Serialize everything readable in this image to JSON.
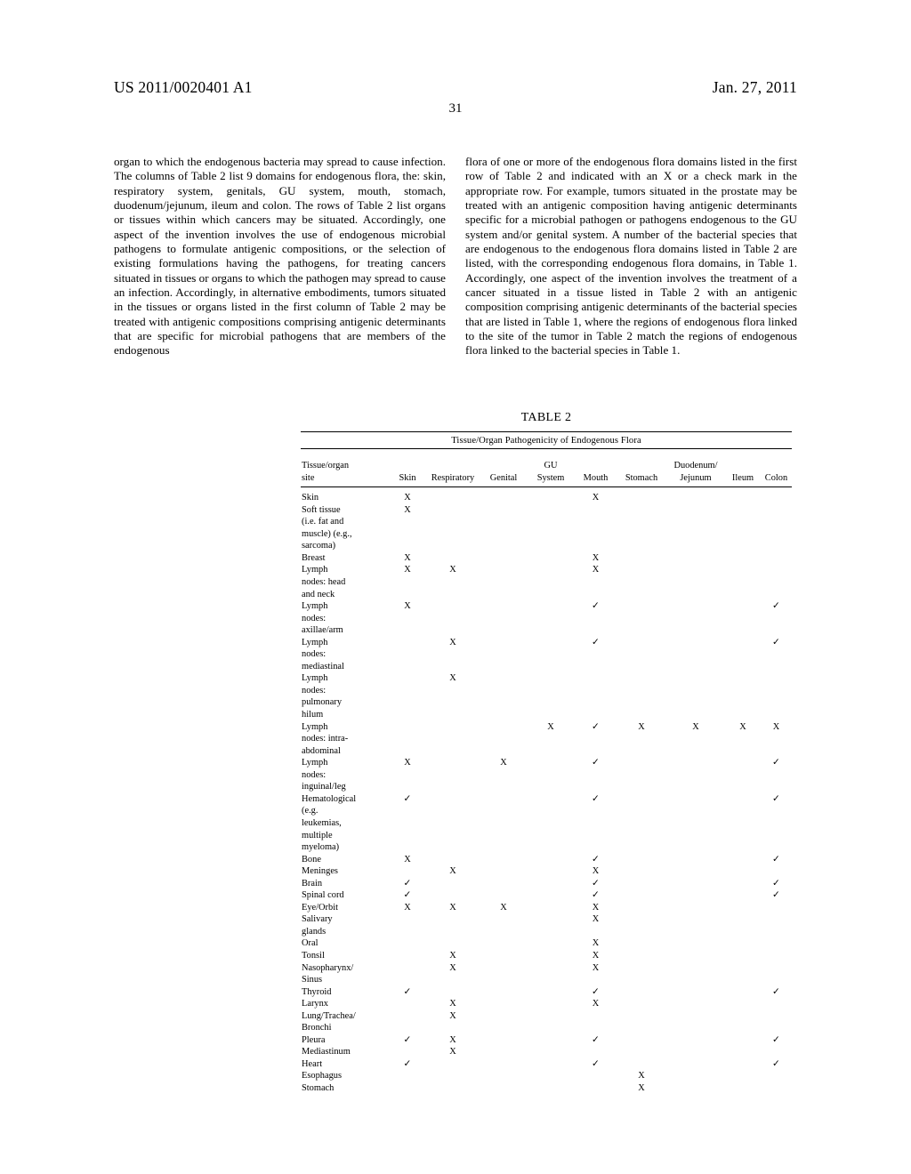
{
  "header": {
    "publication_number": "US 2011/0020401 A1",
    "publication_date": "Jan. 27, 2011",
    "page_number": "31"
  },
  "body": {
    "left_column": "organ to which the endogenous bacteria may spread to cause infection. The columns of Table 2 list 9 domains for endogenous flora, the: skin, respiratory system, genitals, GU system, mouth, stomach, duodenum/jejunum, ileum and colon. The rows of Table 2 list organs or tissues within which cancers may be situated. Accordingly, one aspect of the invention involves the use of endogenous microbial pathogens to formulate antigenic compositions, or the selection of existing formulations having the pathogens, for treating cancers situated in tissues or organs to which the pathogen may spread to cause an infection. Accordingly, in alternative embodiments, tumors situated in the tissues or organs listed in the first column of Table 2 may be treated with antigenic compositions comprising antigenic determinants that are specific for microbial pathogens that are members of the endogenous",
    "right_column": "flora of one or more of the endogenous flora domains listed in the first row of Table 2 and indicated with an X or a check mark in the appropriate row. For example, tumors situated in the prostate may be treated with an antigenic composition having antigenic determinants specific for a microbial pathogen or pathogens endogenous to the GU system and/or genital system. A number of the bacterial species that are endogenous to the endogenous flora domains listed in Table 2 are listed, with the corresponding endogenous flora domains, in Table 1. Accordingly, one aspect of the invention involves the treatment of a cancer situated in a tissue listed in Table 2 with an antigenic composition comprising antigenic determinants of the bacterial species that are listed in Table 1, where the regions of endogenous flora linked to the site of the tumor in Table 2 match the regions of endogenous flora linked to the bacterial species in Table 1."
  },
  "table": {
    "caption": "TABLE 2",
    "subtitle": "Tissue/Organ Pathogenicity of Endogenous Flora",
    "column_headers": [
      {
        "line1": "Tissue/organ",
        "line2": "site"
      },
      {
        "line1": "",
        "line2": "Skin"
      },
      {
        "line1": "",
        "line2": "Respiratory"
      },
      {
        "line1": "",
        "line2": "Genital"
      },
      {
        "line1": "GU",
        "line2": "System"
      },
      {
        "line1": "",
        "line2": "Mouth"
      },
      {
        "line1": "",
        "line2": "Stomach"
      },
      {
        "line1": "Duodenum/",
        "line2": "Jejunum"
      },
      {
        "line1": "",
        "line2": "Ileum"
      },
      {
        "line1": "",
        "line2": "Colon"
      }
    ],
    "mark_x": "X",
    "mark_check": "✓",
    "rows": [
      {
        "site": [
          "Skin"
        ],
        "marks": [
          "X",
          "",
          "",
          "",
          "X",
          "",
          "",
          "",
          ""
        ]
      },
      {
        "site": [
          "Soft tissue",
          "(i.e. fat and",
          "muscle) (e.g.,",
          "sarcoma)"
        ],
        "marks": [
          "X",
          "",
          "",
          "",
          "",
          "",
          "",
          "",
          ""
        ]
      },
      {
        "site": [
          "Breast"
        ],
        "marks": [
          "X",
          "",
          "",
          "",
          "X",
          "",
          "",
          "",
          ""
        ]
      },
      {
        "site": [
          "Lymph",
          "nodes: head",
          "and neck"
        ],
        "marks": [
          "X",
          "X",
          "",
          "",
          "X",
          "",
          "",
          "",
          ""
        ]
      },
      {
        "site": [
          "Lymph",
          "nodes:",
          "axillae/arm"
        ],
        "marks": [
          "X",
          "",
          "",
          "",
          "✓",
          "",
          "",
          "",
          "✓"
        ]
      },
      {
        "site": [
          "Lymph",
          "nodes:",
          "mediastinal"
        ],
        "marks": [
          "",
          "X",
          "",
          "",
          "✓",
          "",
          "",
          "",
          "✓"
        ]
      },
      {
        "site": [
          "Lymph",
          "nodes:",
          "pulmonary",
          "hilum"
        ],
        "marks": [
          "",
          "X",
          "",
          "",
          "",
          "",
          "",
          "",
          ""
        ]
      },
      {
        "site": [
          "Lymph",
          "nodes: intra-",
          "abdominal"
        ],
        "marks": [
          "",
          "",
          "",
          "X",
          "✓",
          "X",
          "X",
          "X",
          "X"
        ]
      },
      {
        "site": [
          "Lymph",
          "nodes:",
          "inguinal/leg"
        ],
        "marks": [
          "X",
          "",
          "X",
          "",
          "✓",
          "",
          "",
          "",
          "✓"
        ]
      },
      {
        "site": [
          "Hematological",
          "(e.g.",
          "leukemias,",
          "multiple",
          "myeloma)"
        ],
        "marks": [
          "✓",
          "",
          "",
          "",
          "✓",
          "",
          "",
          "",
          "✓"
        ]
      },
      {
        "site": [
          "Bone"
        ],
        "marks": [
          "X",
          "",
          "",
          "",
          "✓",
          "",
          "",
          "",
          "✓"
        ]
      },
      {
        "site": [
          "Meninges"
        ],
        "marks": [
          "",
          "X",
          "",
          "",
          "X",
          "",
          "",
          "",
          ""
        ]
      },
      {
        "site": [
          "Brain"
        ],
        "marks": [
          "✓",
          "",
          "",
          "",
          "✓",
          "",
          "",
          "",
          "✓"
        ]
      },
      {
        "site": [
          "Spinal cord"
        ],
        "marks": [
          "✓",
          "",
          "",
          "",
          "✓",
          "",
          "",
          "",
          "✓"
        ]
      },
      {
        "site": [
          "Eye/Orbit"
        ],
        "marks": [
          "X",
          "X",
          "X",
          "",
          "X",
          "",
          "",
          "",
          ""
        ]
      },
      {
        "site": [
          "Salivary",
          "glands"
        ],
        "marks": [
          "",
          "",
          "",
          "",
          "X",
          "",
          "",
          "",
          ""
        ]
      },
      {
        "site": [
          "Oral"
        ],
        "marks": [
          "",
          "",
          "",
          "",
          "X",
          "",
          "",
          "",
          ""
        ]
      },
      {
        "site": [
          "Tonsil"
        ],
        "marks": [
          "",
          "X",
          "",
          "",
          "X",
          "",
          "",
          "",
          ""
        ]
      },
      {
        "site": [
          "Nasopharynx/",
          "Sinus"
        ],
        "marks": [
          "",
          "X",
          "",
          "",
          "X",
          "",
          "",
          "",
          ""
        ]
      },
      {
        "site": [
          "Thyroid"
        ],
        "marks": [
          "✓",
          "",
          "",
          "",
          "✓",
          "",
          "",
          "",
          "✓"
        ]
      },
      {
        "site": [
          "Larynx"
        ],
        "marks": [
          "",
          "X",
          "",
          "",
          "X",
          "",
          "",
          "",
          ""
        ]
      },
      {
        "site": [
          "Lung/Trachea/",
          "Bronchi"
        ],
        "marks": [
          "",
          "X",
          "",
          "",
          "",
          "",
          "",
          "",
          ""
        ]
      },
      {
        "site": [
          "Pleura"
        ],
        "marks": [
          "✓",
          "X",
          "",
          "",
          "✓",
          "",
          "",
          "",
          "✓"
        ]
      },
      {
        "site": [
          "Mediastinum"
        ],
        "marks": [
          "",
          "X",
          "",
          "",
          "",
          "",
          "",
          "",
          ""
        ]
      },
      {
        "site": [
          "Heart"
        ],
        "marks": [
          "✓",
          "",
          "",
          "",
          "✓",
          "",
          "",
          "",
          "✓"
        ]
      },
      {
        "site": [
          "Esophagus"
        ],
        "marks": [
          "",
          "",
          "",
          "",
          "",
          "X",
          "",
          "",
          ""
        ]
      },
      {
        "site": [
          "Stomach"
        ],
        "marks": [
          "",
          "",
          "",
          "",
          "",
          "X",
          "",
          "",
          ""
        ]
      }
    ]
  }
}
